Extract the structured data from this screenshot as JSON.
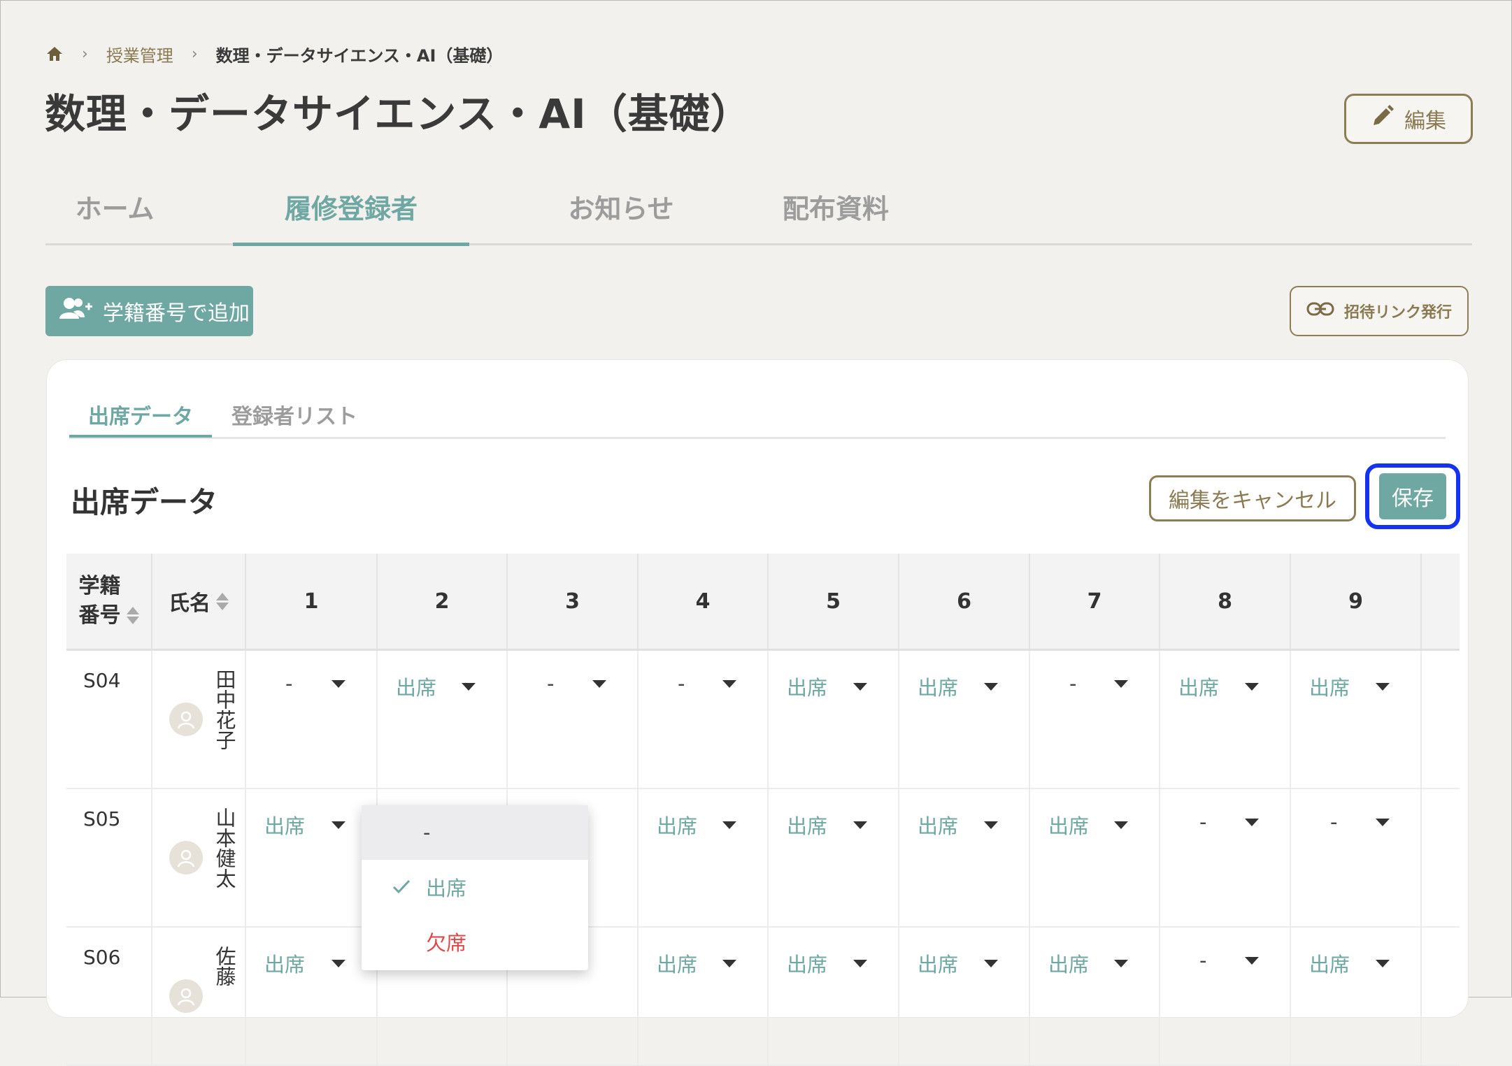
{
  "breadcrumb": {
    "item1": "授業管理",
    "current": "数理・データサイエンス・AI（基礎）"
  },
  "page": {
    "title": "数理・データサイエンス・AI（基礎）",
    "edit_label": "編集"
  },
  "tabs": [
    "ホーム",
    "履修登録者",
    "お知らせ",
    "配布資料"
  ],
  "actions": {
    "add_label": "学籍番号で追加",
    "invite_label": "招待リンク発行"
  },
  "subtabs": [
    "出席データ",
    "登録者リスト"
  ],
  "section": {
    "title": "出席データ",
    "cancel_label": "編集をキャンセル",
    "save_label": "保存"
  },
  "table": {
    "col_id": "学籍番号",
    "col_id_l1": "学籍",
    "col_id_l2": "番号",
    "col_name": "氏名",
    "sessions": [
      "1",
      "2",
      "3",
      "4",
      "5",
      "6",
      "7",
      "8",
      "9"
    ]
  },
  "rows": [
    {
      "id": "S04",
      "name": "田中花子",
      "att": [
        "-",
        "出席",
        "-",
        "-",
        "出席",
        "出席",
        "-",
        "出席",
        "出席"
      ]
    },
    {
      "id": "S05",
      "name": "山本健太",
      "att": [
        "出席",
        "",
        "",
        "出席",
        "出席",
        "出席",
        "出席",
        "-",
        "-"
      ]
    },
    {
      "id": "S06",
      "name": "佐藤",
      "att": [
        "出席",
        "",
        "",
        "出席",
        "出席",
        "出席",
        "出席",
        "-",
        "出席"
      ]
    }
  ],
  "dropdown": {
    "options": [
      "-",
      "出席",
      "欠席"
    ],
    "selected": "出席"
  },
  "colors": {
    "accent": "#6fa8a2",
    "brand_brown": "#8a7a52",
    "absent": "#e04848",
    "focus_ring": "#1432f0"
  }
}
